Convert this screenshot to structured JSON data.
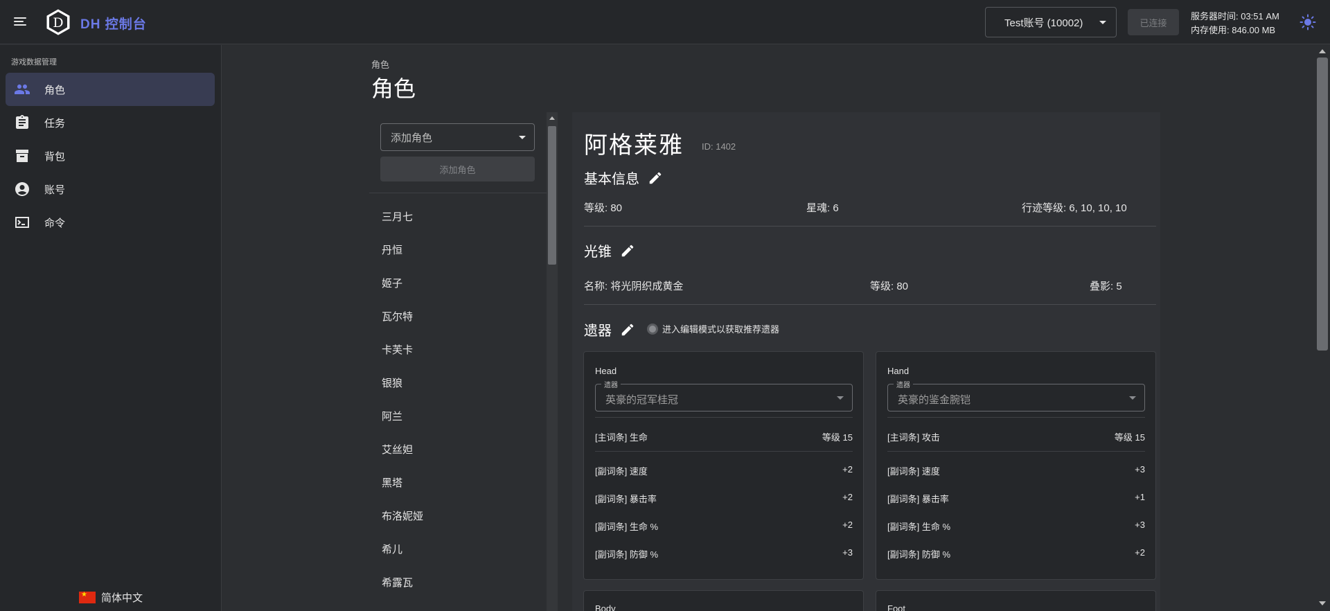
{
  "header": {
    "app_title": "DH 控制台",
    "logo_letter": "D",
    "account": "Test账号 (10002)",
    "connect_label": "已连接",
    "server_time": "服务器时间: 03:51 AM",
    "memory": "内存使用: 846.00 MB"
  },
  "sidebar": {
    "header": "游戏数据管理",
    "items": [
      {
        "label": "角色",
        "icon": "people-icon"
      },
      {
        "label": "任务",
        "icon": "clipboard-icon"
      },
      {
        "label": "背包",
        "icon": "archive-icon"
      },
      {
        "label": "账号",
        "icon": "account-circle-icon"
      },
      {
        "label": "命令",
        "icon": "terminal-icon"
      }
    ],
    "language": "简体中文"
  },
  "page": {
    "breadcrumb": "角色",
    "title": "角色"
  },
  "character_list": {
    "add_placeholder": "添加角色",
    "add_button": "添加角色",
    "items": [
      "三月七",
      "丹恒",
      "姬子",
      "瓦尔特",
      "卡芙卡",
      "银狼",
      "阿兰",
      "艾丝妲",
      "黑塔",
      "布洛妮娅",
      "希儿",
      "希露瓦"
    ]
  },
  "detail": {
    "name": "阿格莱雅",
    "id": "ID: 1402",
    "basic": {
      "title": "基本信息",
      "level": "等级: 80",
      "eidolon": "星魂: 6",
      "trace": "行迹等级: 6, 10, 10, 10"
    },
    "lightcone": {
      "title": "光锥",
      "name": "名称: 将光阴织成黄金",
      "level": "等级: 80",
      "superimpose": "叠影: 5"
    },
    "relics": {
      "title": "遗器",
      "toggle_label": "进入编辑模式以获取推荐遗器",
      "field_legend": "遗器",
      "cards": [
        {
          "slot": "Head",
          "name": "英豪的冠军桂冠",
          "main_label": "[主词条] 生命",
          "main_value": "等级 15",
          "subs": [
            {
              "label": "[副词条] 速度",
              "value": "+2"
            },
            {
              "label": "[副词条] 暴击率",
              "value": "+2"
            },
            {
              "label": "[副词条] 生命 %",
              "value": "+2"
            },
            {
              "label": "[副词条] 防御 %",
              "value": "+3"
            }
          ]
        },
        {
          "slot": "Hand",
          "name": "英豪的鉴金腕铠",
          "main_label": "[主词条] 攻击",
          "main_value": "等级 15",
          "subs": [
            {
              "label": "[副词条] 速度",
              "value": "+3"
            },
            {
              "label": "[副词条] 暴击率",
              "value": "+1"
            },
            {
              "label": "[副词条] 生命 %",
              "value": "+3"
            },
            {
              "label": "[副词条] 防御 %",
              "value": "+2"
            }
          ]
        },
        {
          "slot": "Body"
        },
        {
          "slot": "Foot"
        }
      ]
    }
  },
  "colors": {
    "accent": "#6b79e6",
    "background": "#2c2e31",
    "surface": "#25272a"
  }
}
